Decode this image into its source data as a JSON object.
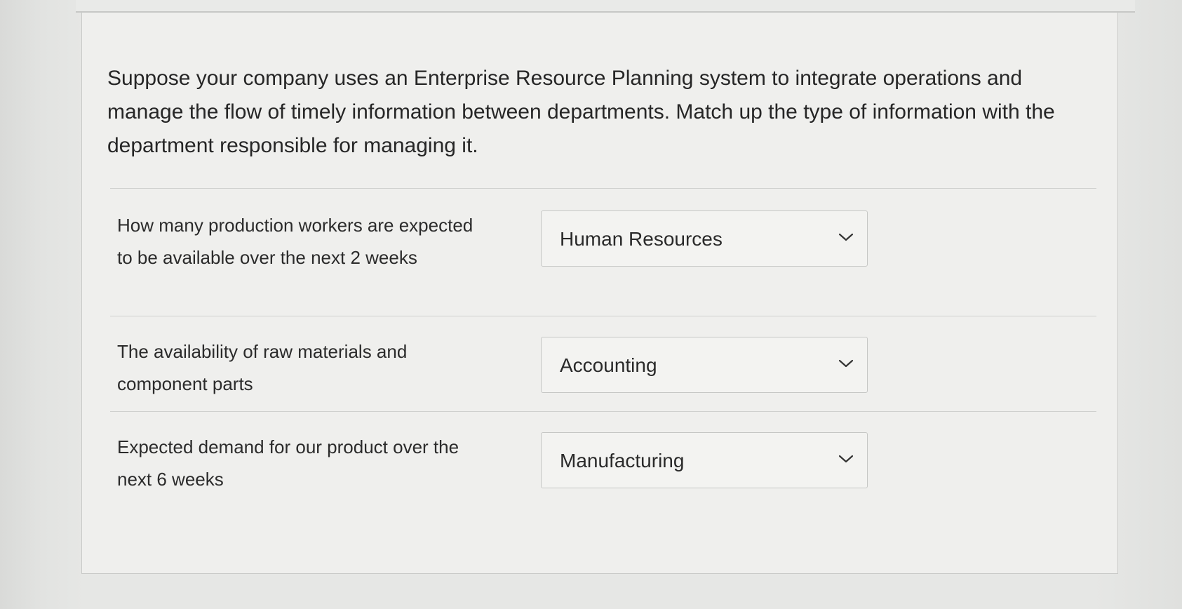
{
  "question": {
    "prompt": "Suppose your company uses an Enterprise Resource Planning system to integrate operations and manage the flow of timely information between departments. Match up the type of information with the department responsible for managing it."
  },
  "matches": [
    {
      "label": "How many production workers are expected to be available over the next 2 weeks",
      "selected": "Human Resources",
      "icon": "chevron-down-icon"
    },
    {
      "label": "The availability of raw materials and component parts",
      "selected": "Accounting",
      "icon": "chevron-down-icon"
    },
    {
      "label": "Expected demand for our product over the next 6 weeks",
      "selected": "Manufacturing",
      "icon": "chevron-down-icon"
    }
  ]
}
